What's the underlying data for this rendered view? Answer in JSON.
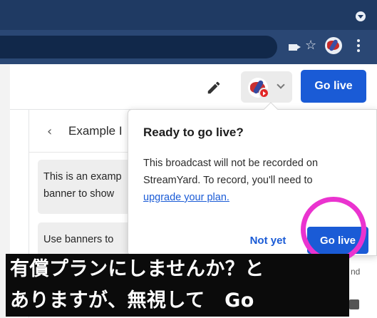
{
  "browser": {
    "icons": [
      "camera-icon",
      "star-icon",
      "profile-avatar",
      "kebab-menu-icon"
    ]
  },
  "header": {
    "go_live_label": "Go live",
    "icons": [
      "pencil-icon",
      "youtube-badge-icon",
      "chevron-down-icon"
    ]
  },
  "panel": {
    "back_glyph": "‹",
    "title": "Example I",
    "banners": [
      {
        "lines": [
          "This is an examp",
          "banner to show"
        ]
      },
      {
        "lines": [
          "Use banners to"
        ]
      }
    ]
  },
  "popover": {
    "title": "Ready to go live?",
    "body_line_1": "This broadcast will not be recorded on",
    "body_line_2": "StreamYard. To record, you'll need to",
    "link_text": "upgrade your plan.",
    "not_yet_label": "Not yet",
    "go_live_label": "Go live"
  },
  "subtitles": {
    "line_1": "有償プランにしませんか？と",
    "line_2": "ありますが、無視して　Go"
  },
  "peek": {
    "text": "nd"
  },
  "colors": {
    "accent": "#1a5bd6",
    "highlight": "#ea33cf",
    "browser_bar": "#1f3a63"
  }
}
